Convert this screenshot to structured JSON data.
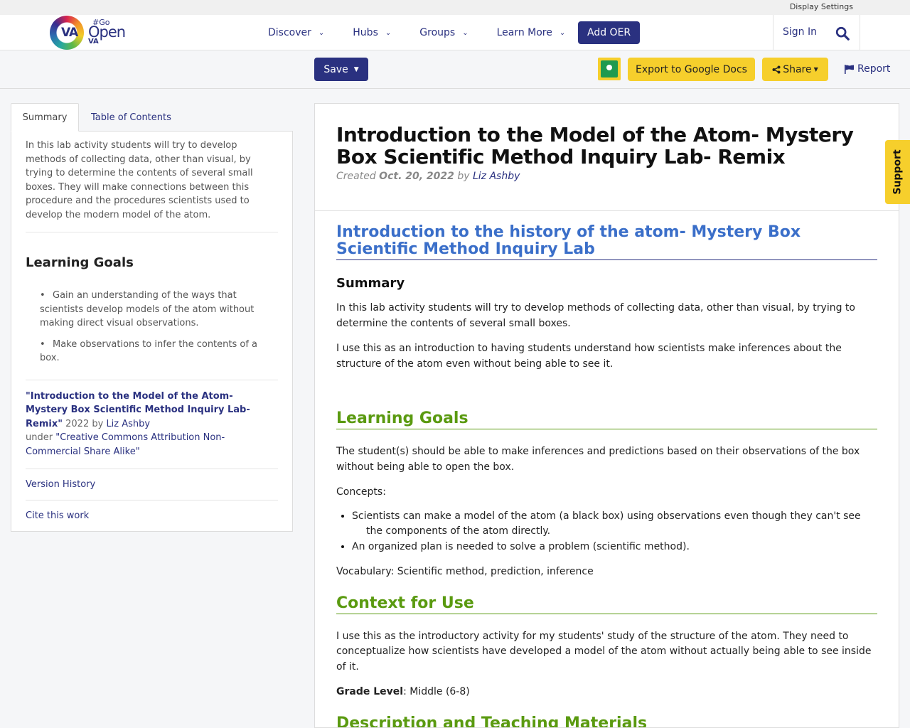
{
  "utility": {
    "display_settings": "Display Settings"
  },
  "header": {
    "logo": {
      "va": "VA",
      "go": "#Go",
      "open": "Open",
      "va2": "VA"
    },
    "nav": [
      "Discover",
      "Hubs",
      "Groups",
      "Learn More"
    ],
    "add_oer": "Add OER",
    "sign_in": "Sign In"
  },
  "toolbar": {
    "save": "Save",
    "export": "Export to Google Docs",
    "share": "Share",
    "report": "Report"
  },
  "sidebar": {
    "tabs": [
      "Summary",
      "Table of Contents"
    ],
    "summary": "In this lab activity students will try to develop methods of collecting data, other than visual, by trying to determine the contents of several small boxes. They will make connections between this procedure and the procedures scientists used to develop the modern model of the atom.",
    "learning_goals_heading": "Learning Goals",
    "learning_goals": [
      "Gain an understanding of the ways that scientists develop models of the atom without making direct visual observations.",
      "Make observations to infer the contents of a box."
    ],
    "attribution": {
      "title": "\"Introduction to the Model of the Atom- Mystery Box Scientific Method Inquiry Lab- Remix\"",
      "year_by": " 2022 by ",
      "author": "Liz Ashby",
      "under": "under ",
      "license": "\"Creative Commons Attribution Non-Commercial Share Alike\""
    },
    "version_history": "Version History",
    "cite": "Cite this work"
  },
  "main": {
    "title": "Introduction to the Model of the Atom- Mystery Box Scientific Method Inquiry Lab- Remix",
    "created_label": "Created ",
    "created_date": "Oct. 20, 2022",
    "by": " by ",
    "author": "Liz Ashby",
    "section_title": "Introduction to the history of the atom- Mystery Box Scientific Method Inquiry Lab",
    "summary_heading": "Summary",
    "summary_p1": "In this lab activity students will try to develop methods of collecting data, other than visual, by trying to determine the contents of several small boxes.",
    "summary_p2": "I use this as an introduction to having students understand how scientists make inferences about the structure of the atom even without being able to see it.",
    "learning_goals_heading": "Learning Goals",
    "learning_goals_p": "The student(s) should be able to make inferences and predictions based on their observations of the box without being able to open the box.",
    "concepts_label": "Concepts:",
    "concepts": [
      "Scientists can make a model of the atom (a black box) using observations even though they can't see the components of the atom directly.",
      "An organized plan is needed to solve a problem (scientific method)."
    ],
    "vocabulary": "Vocabulary: Scientific method, prediction, inference",
    "context_heading": "Context for Use",
    "context_p": "I use this as the introductory activity for my students' study of the structure of the atom.  They need to conceptualize how scientists have developed a model of the atom without actually being able to see inside of it.",
    "grade_label": "Grade Level",
    "grade_value": ": Middle (6-8)",
    "description_heading": "Description and Teaching Materials"
  },
  "support": "Support",
  "colors": {
    "brand": "#2a3180",
    "accent_yellow": "#f6cf2c",
    "section_green": "#5a9a10",
    "section_blue": "#3b6fc9"
  },
  "icons": [
    "chevron-down-icon",
    "search-icon",
    "google-classroom-icon",
    "share-icon",
    "flag-icon",
    "caret-down-icon"
  ]
}
